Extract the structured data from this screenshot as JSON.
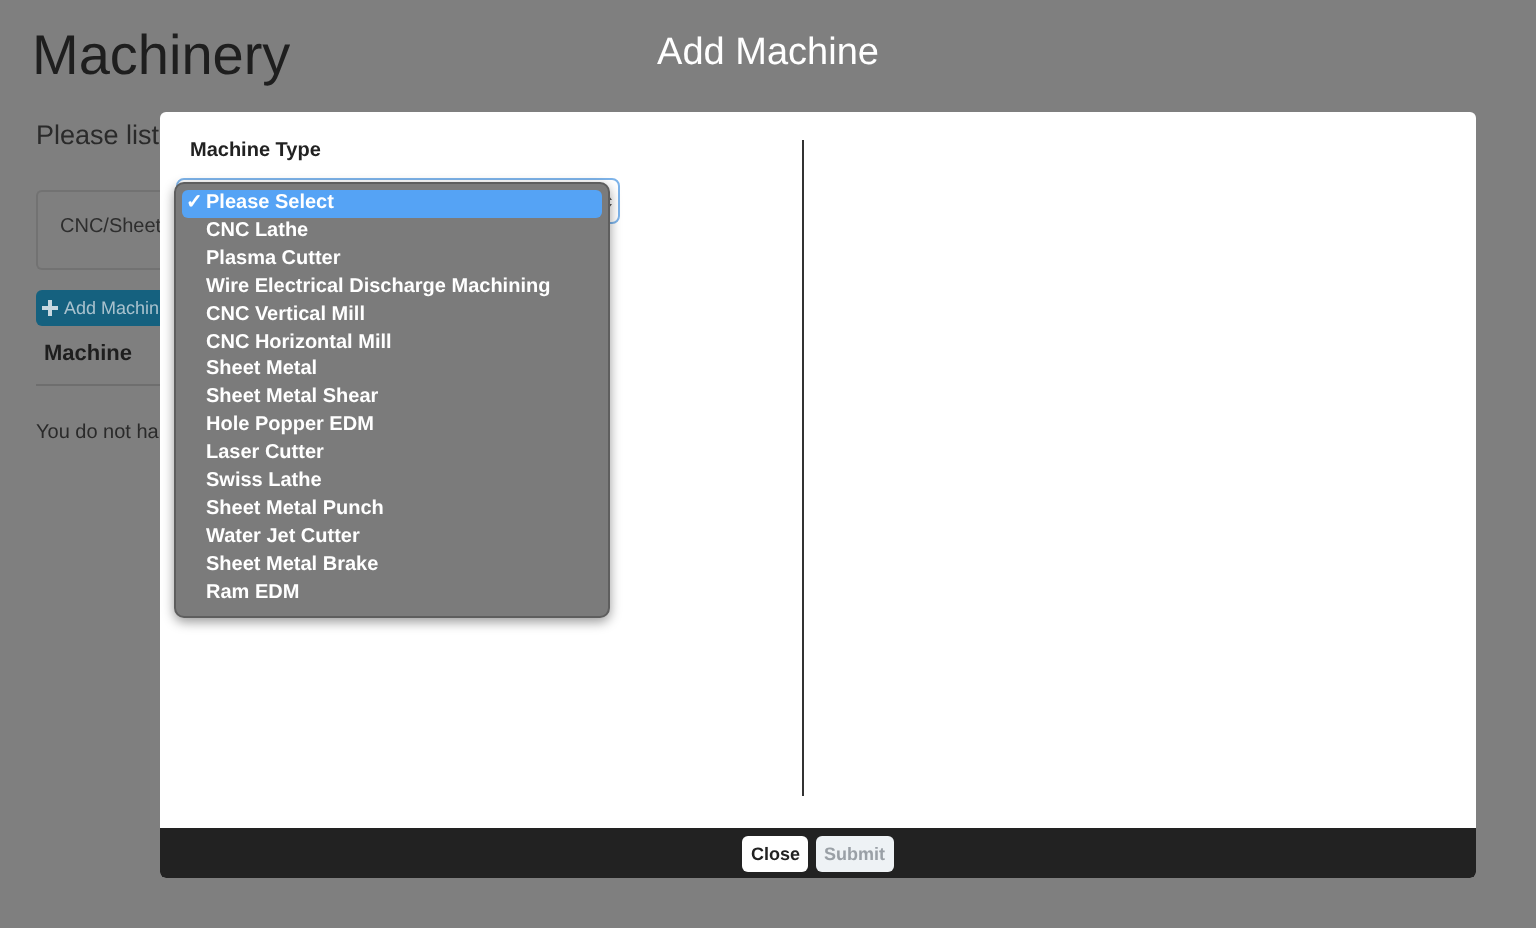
{
  "page": {
    "title": "Machinery",
    "intro": "Please list",
    "filter": "CNC/Sheet",
    "add_button": "Add Machin",
    "table": {
      "columns": [
        "Machine"
      ]
    },
    "empty": "You do not ha"
  },
  "modal": {
    "title": "Add Machine",
    "field_label": "Machine Type",
    "check_mark": "✓",
    "options": [
      {
        "label": "Please Select",
        "selected": true
      },
      {
        "label": "CNC Lathe",
        "selected": false
      },
      {
        "label": "Plasma Cutter",
        "selected": false
      },
      {
        "label": "Wire Electrical Discharge Machining",
        "selected": false
      },
      {
        "label": "CNC Vertical Mill",
        "selected": false
      },
      {
        "label": "CNC Horizontal Mill",
        "selected": false
      },
      {
        "label": "Sheet Metal",
        "selected": false
      },
      {
        "label": "Sheet Metal Shear",
        "selected": false
      },
      {
        "label": "Hole Popper EDM",
        "selected": false
      },
      {
        "label": "Laser Cutter",
        "selected": false
      },
      {
        "label": "Swiss Lathe",
        "selected": false
      },
      {
        "label": "Sheet Metal Punch",
        "selected": false
      },
      {
        "label": "Water Jet Cutter",
        "selected": false
      },
      {
        "label": "Sheet Metal Brake",
        "selected": false
      },
      {
        "label": "Ram EDM",
        "selected": false
      }
    ],
    "buttons": [
      {
        "label": "Close",
        "disabled": false
      },
      {
        "label": "Submit",
        "disabled": true
      }
    ]
  }
}
